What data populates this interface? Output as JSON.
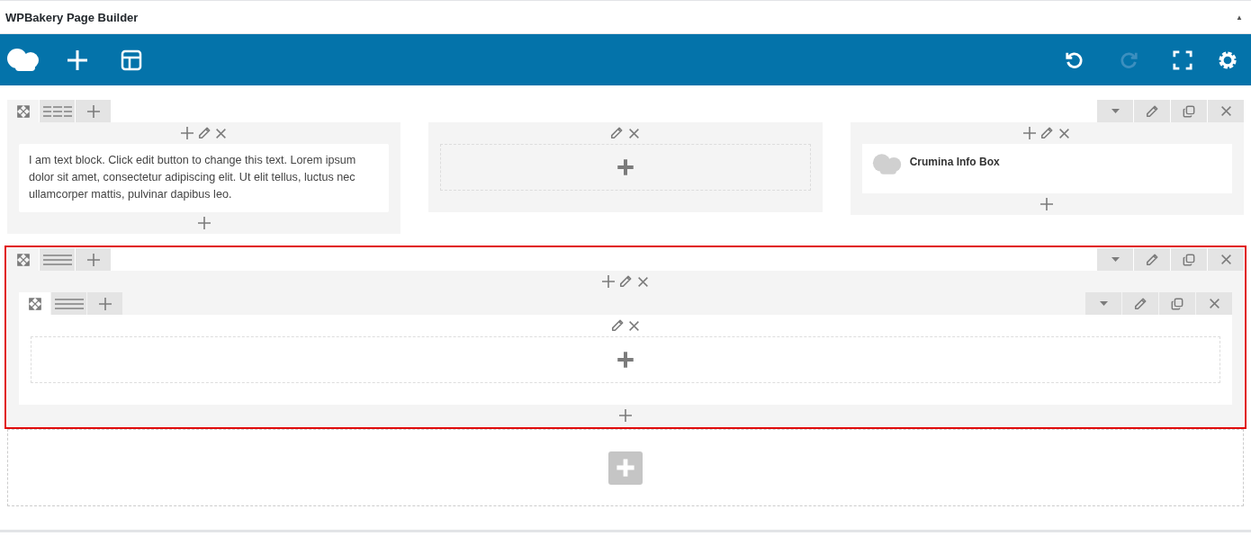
{
  "panel": {
    "title": "WPBakery Page Builder",
    "collapse_icon": "▲"
  },
  "toolbar": {
    "left": [
      {
        "kind": "logo"
      },
      {
        "kind": "add"
      },
      {
        "kind": "templates"
      }
    ],
    "right": [
      {
        "kind": "undo",
        "disabled": false
      },
      {
        "kind": "redo",
        "disabled": true
      },
      {
        "kind": "fullscreen"
      },
      {
        "kind": "settings"
      }
    ]
  },
  "rows": [
    {
      "selected": false,
      "kind": "thirds",
      "columns": [
        {
          "elements": [
            {
              "kind": "text",
              "text": "I am text block. Click edit button to change this text. Lorem ipsum dolor sit amet, consectetur adipiscing elit. Ut elit tellus, luctus nec ullamcorper mattis, pulvinar dapibus leo."
            }
          ]
        },
        {},
        {
          "elements": [
            {
              "kind": "infobox",
              "title": "Crumina Info Box"
            }
          ]
        }
      ]
    },
    {
      "selected": true,
      "kind": "full",
      "columns": [
        {
          "elements": [
            {
              "kind": "inner_row",
              "columns": [
                {}
              ]
            }
          ]
        }
      ]
    }
  ]
}
